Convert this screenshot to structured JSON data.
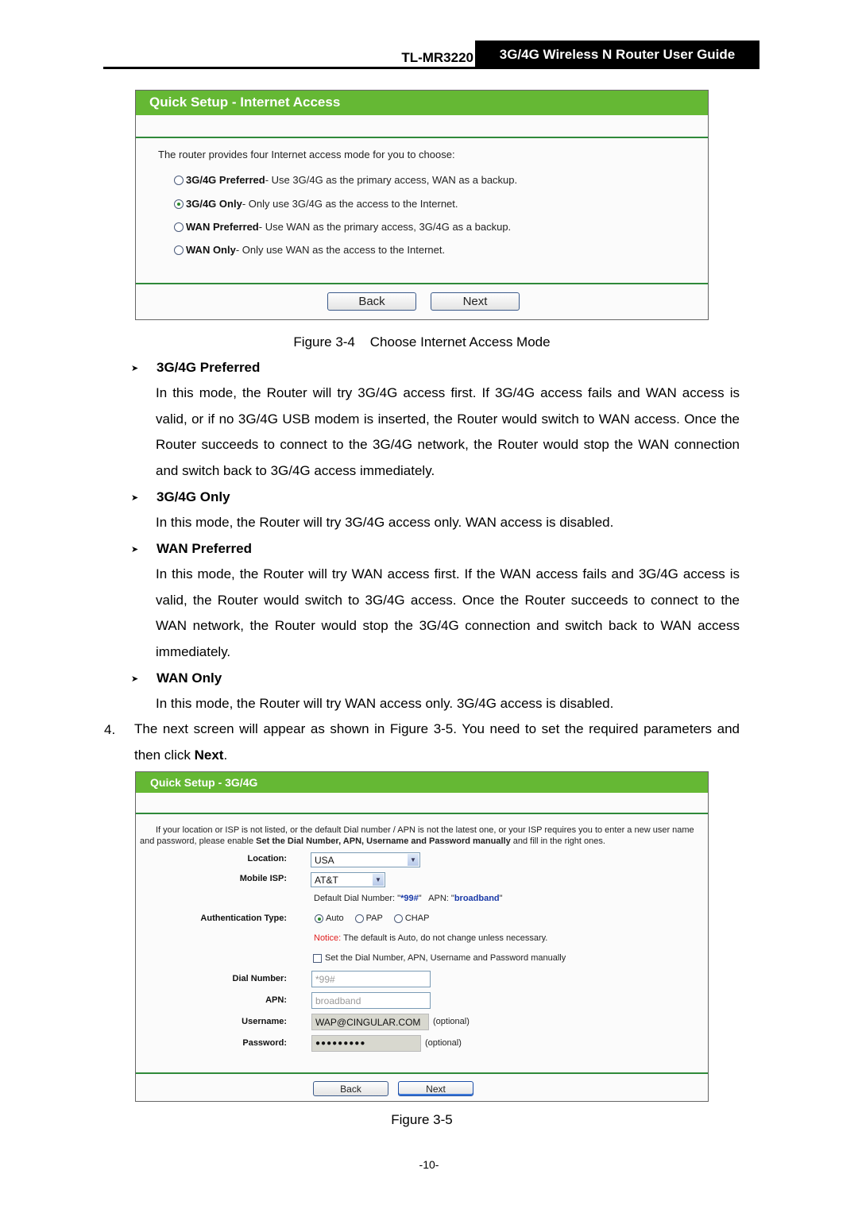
{
  "header": {
    "model": "TL-MR3220",
    "guide_title": "3G/4G Wireless N Router User Guide"
  },
  "figure1": {
    "title": "Quick Setup - Internet Access",
    "intro": "The router provides four Internet access mode for you to choose:",
    "options": [
      {
        "name": "3G/4G Preferred",
        "desc": " - Use 3G/4G as the primary access, WAN as a backup.",
        "selected": false
      },
      {
        "name": "3G/4G Only",
        "desc": " - Only use 3G/4G as the access to the Internet.",
        "selected": true
      },
      {
        "name": "WAN Preferred",
        "desc": " - Use WAN as the primary access, 3G/4G as a backup.",
        "selected": false
      },
      {
        "name": "WAN Only",
        "desc": " - Only use WAN as the access to the Internet.",
        "selected": false
      }
    ],
    "back_label": "Back",
    "next_label": "Next",
    "caption": "Figure 3-4    Choose Internet Access Mode"
  },
  "modes": [
    {
      "title": "3G/4G Preferred",
      "text": "In this mode, the Router will try 3G/4G access first. If 3G/4G access fails and WAN access is valid, or if no 3G/4G USB modem is inserted, the Router would switch to WAN access. Once the Router succeeds to connect to the 3G/4G network, the Router would stop the WAN connection and switch back to 3G/4G access immediately."
    },
    {
      "title": "3G/4G Only",
      "text": "In this mode, the Router will try 3G/4G access only. WAN access is disabled."
    },
    {
      "title": "WAN Preferred",
      "text": "In this mode, the Router will try WAN access first. If the WAN access fails and 3G/4G access is valid, the Router would switch to 3G/4G access. Once the Router succeeds to connect to the WAN network, the Router would stop the 3G/4G connection and switch back to WAN access immediately."
    },
    {
      "title": "WAN Only",
      "text": "In this mode, the Router will try WAN access only. 3G/4G access is disabled."
    }
  ],
  "step4": {
    "number": "4.",
    "text_before": "The next screen will appear as shown in Figure 3-5. You need to set the required parameters and then click ",
    "bold": "Next",
    "text_after": "."
  },
  "figure2": {
    "title": "Quick Setup - 3G/4G",
    "intro_before": "If your location or ISP is not listed, or the default Dial number / APN is not the latest one, or your ISP requires you to enter a new user name and password, please enable ",
    "intro_bold": "Set the Dial Number, APN, Username and Password manually",
    "intro_after": " and fill in the right ones.",
    "location_label": "Location:",
    "location_value": "USA",
    "isp_label": "Mobile ISP:",
    "isp_value": "AT&T",
    "default_dial_prefix": "Default Dial Number: \"",
    "default_dial_value": "*99#",
    "apn_prefix": "\"   APN: \"",
    "default_apn_value": "broadband",
    "apn_suffix": "\"",
    "auth_label": "Authentication Type:",
    "auth_options": [
      {
        "label": "Auto",
        "selected": true
      },
      {
        "label": "PAP",
        "selected": false
      },
      {
        "label": "CHAP",
        "selected": false
      }
    ],
    "notice_label": "Notice:",
    "notice_text": " The default is Auto, do not change unless necessary.",
    "manual_checkbox_label": "Set the Dial Number, APN, Username and Password manually",
    "manual_checked": false,
    "dial_label": "Dial Number:",
    "dial_value": "*99#",
    "apn_label": "APN:",
    "apn_value": "broadband",
    "username_label": "Username:",
    "username_value": "WAP@CINGULAR.COM",
    "password_label": "Password:",
    "password_value": "●●●●●●●●●",
    "optional": "(optional)",
    "back_label": "Back",
    "next_label": "Next",
    "caption": "Figure 3-5"
  },
  "page_number": "-10-",
  "colors": {
    "green_bar": "#65b834",
    "divider_green": "#2f8a3a",
    "notice_red": "#e02020",
    "value_blue": "#1a3aa8"
  }
}
